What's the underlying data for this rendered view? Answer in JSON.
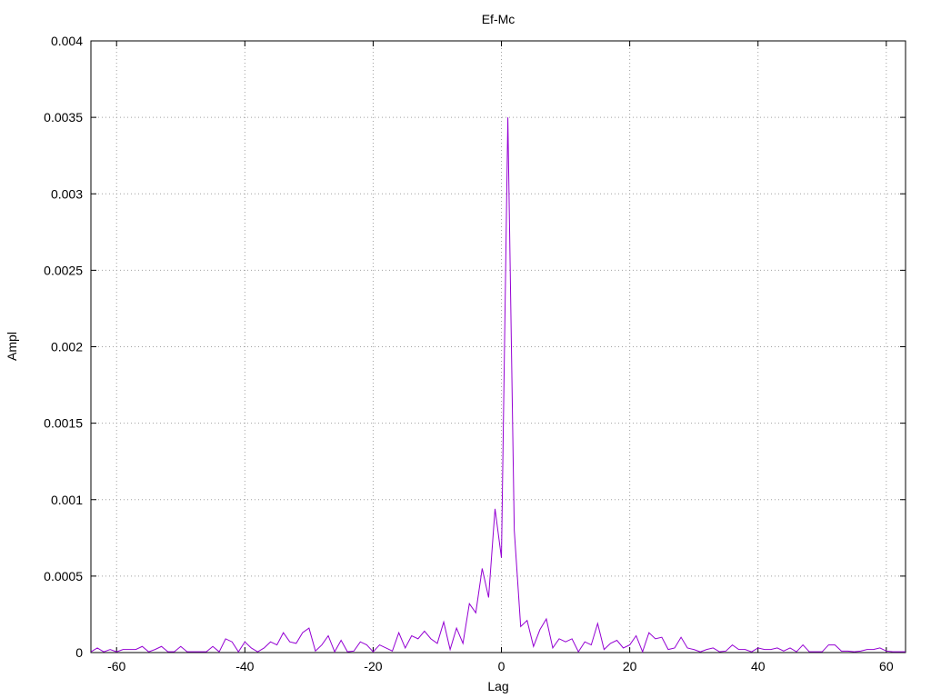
{
  "chart_data": {
    "type": "line",
    "title": "Ef-Mc",
    "xlabel": "Lag",
    "ylabel": "Ampl",
    "xlim": [
      -64,
      63
    ],
    "ylim": [
      0,
      0.004
    ],
    "grid": true,
    "x_ticks": [
      -60,
      -40,
      -20,
      0,
      20,
      40,
      60
    ],
    "x_tick_labels": [
      "-60",
      "-40",
      "-20",
      "0",
      "20",
      "40",
      "60"
    ],
    "y_ticks": [
      0,
      0.0005,
      0.001,
      0.0015,
      0.002,
      0.0025,
      0.003,
      0.0035,
      0.004
    ],
    "y_tick_labels": [
      "0",
      "0.0005",
      "0.001",
      "0.0015",
      "0.002",
      "0.0025",
      "0.003",
      "0.0035",
      "0.004"
    ],
    "series": [
      {
        "color": "#9400d3",
        "x": [
          -64,
          -63,
          -62,
          -61,
          -60,
          -59,
          -58,
          -57,
          -56,
          -55,
          -54,
          -53,
          -52,
          -51,
          -50,
          -49,
          -48,
          -47,
          -46,
          -45,
          -44,
          -43,
          -42,
          -41,
          -40,
          -39,
          -38,
          -37,
          -36,
          -35,
          -34,
          -33,
          -32,
          -31,
          -30,
          -29,
          -28,
          -27,
          -26,
          -25,
          -24,
          -23,
          -22,
          -21,
          -20,
          -19,
          -18,
          -17,
          -16,
          -15,
          -14,
          -13,
          -12,
          -11,
          -10,
          -9,
          -8,
          -7,
          -6,
          -5,
          -4,
          -3,
          -2,
          -1,
          0,
          1,
          2,
          3,
          4,
          5,
          6,
          7,
          8,
          9,
          10,
          11,
          12,
          13,
          14,
          15,
          16,
          17,
          18,
          19,
          20,
          21,
          22,
          23,
          24,
          25,
          26,
          27,
          28,
          29,
          30,
          31,
          32,
          33,
          34,
          35,
          36,
          37,
          38,
          39,
          40,
          41,
          42,
          43,
          44,
          45,
          46,
          47,
          48,
          49,
          50,
          51,
          52,
          53,
          54,
          55,
          56,
          57,
          58,
          59,
          60,
          61,
          62,
          63
        ],
        "y": [
          5e-06,
          3e-05,
          5e-06,
          2e-05,
          5e-06,
          2e-05,
          2e-05,
          2e-05,
          4e-05,
          5e-06,
          2e-05,
          4e-05,
          5e-06,
          5e-06,
          4e-05,
          5e-06,
          5e-06,
          5e-06,
          5e-06,
          4e-05,
          5e-06,
          9e-05,
          7e-05,
          5e-06,
          7e-05,
          3e-05,
          5e-06,
          3e-05,
          7e-05,
          5e-05,
          0.00013,
          7e-05,
          6e-05,
          0.00013,
          0.00016,
          1e-05,
          5e-05,
          0.00011,
          5e-06,
          8e-05,
          5e-06,
          1e-05,
          7e-05,
          5e-05,
          5e-06,
          5e-05,
          3e-05,
          1e-05,
          0.00013,
          3e-05,
          0.00011,
          9e-05,
          0.00014,
          9e-05,
          6e-05,
          0.0002,
          2e-05,
          0.00016,
          6e-05,
          0.00032,
          0.00026,
          0.00055,
          0.00036,
          0.00094,
          0.00062,
          0.0035,
          0.0008,
          0.00017,
          0.00021,
          4e-05,
          0.00015,
          0.00022,
          3e-05,
          9e-05,
          7e-05,
          9e-05,
          5e-06,
          7e-05,
          5e-05,
          0.00019,
          2e-05,
          6e-05,
          8e-05,
          3e-05,
          5e-05,
          0.00011,
          5e-06,
          0.00013,
          9e-05,
          0.0001,
          2e-05,
          3e-05,
          0.0001,
          3e-05,
          2e-05,
          5e-06,
          2e-05,
          3e-05,
          5e-06,
          1e-05,
          5e-05,
          2e-05,
          2e-05,
          5e-06,
          3e-05,
          2e-05,
          2e-05,
          3e-05,
          1e-05,
          3e-05,
          5e-06,
          5e-05,
          5e-06,
          5e-06,
          5e-06,
          5e-05,
          5e-05,
          1e-05,
          1e-05,
          5e-06,
          1e-05,
          2e-05,
          2e-05,
          3e-05,
          1e-05,
          5e-06,
          5e-06,
          5e-06
        ]
      }
    ]
  }
}
